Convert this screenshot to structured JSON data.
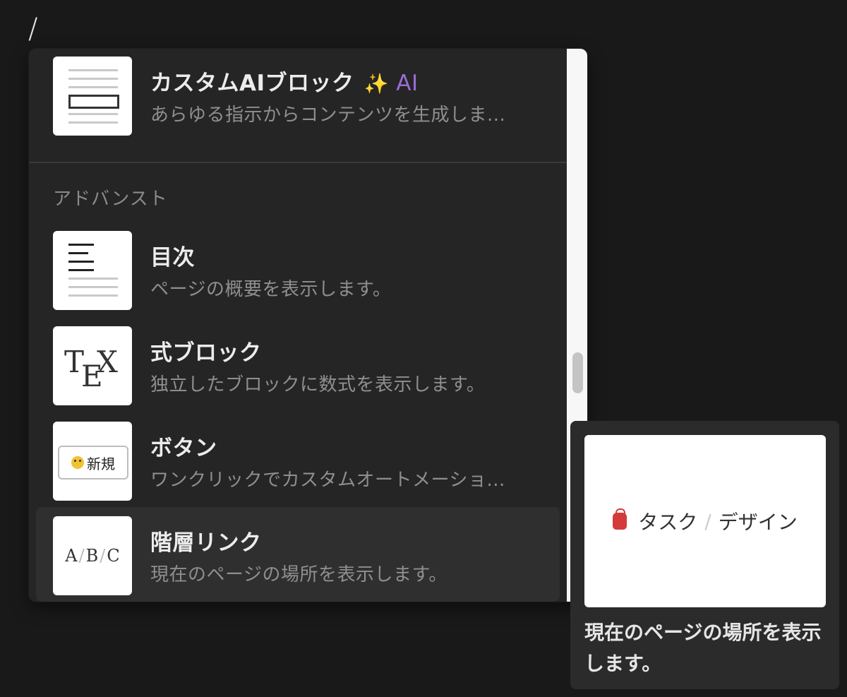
{
  "editor": {
    "slash": "/"
  },
  "menu": {
    "ai_item": {
      "title": "カスタムAIブロック",
      "badge_spark": "✨",
      "badge": "AI",
      "desc": "あらゆる指示からコンテンツを生成しま..."
    },
    "section_label": "アドバンスト",
    "items": [
      {
        "title": "目次",
        "desc": "ページの概要を表示します。",
        "thumb": "toc"
      },
      {
        "title": "式ブロック",
        "desc": "独立したブロックに数式を表示します。",
        "thumb": "tex",
        "thumb_text": [
          "T",
          "E",
          "X"
        ]
      },
      {
        "title": "ボタン",
        "desc": "ワンクリックでカスタムオートメーショ...",
        "thumb": "button",
        "thumb_text": "新規"
      },
      {
        "title": "階層リンク",
        "desc": "現在のページの場所を表示します。",
        "thumb": "breadcrumb",
        "thumb_text": [
          "A",
          "B",
          "C"
        ]
      }
    ],
    "selected_index": 3
  },
  "preview": {
    "crumb_1": "タスク",
    "crumb_sep": "/",
    "crumb_2": "デザイン",
    "desc": "現在のページの場所を表示します。"
  },
  "colors": {
    "accent_ai": "#9a6dd7",
    "background": "#191919",
    "menu_bg": "#252525"
  }
}
